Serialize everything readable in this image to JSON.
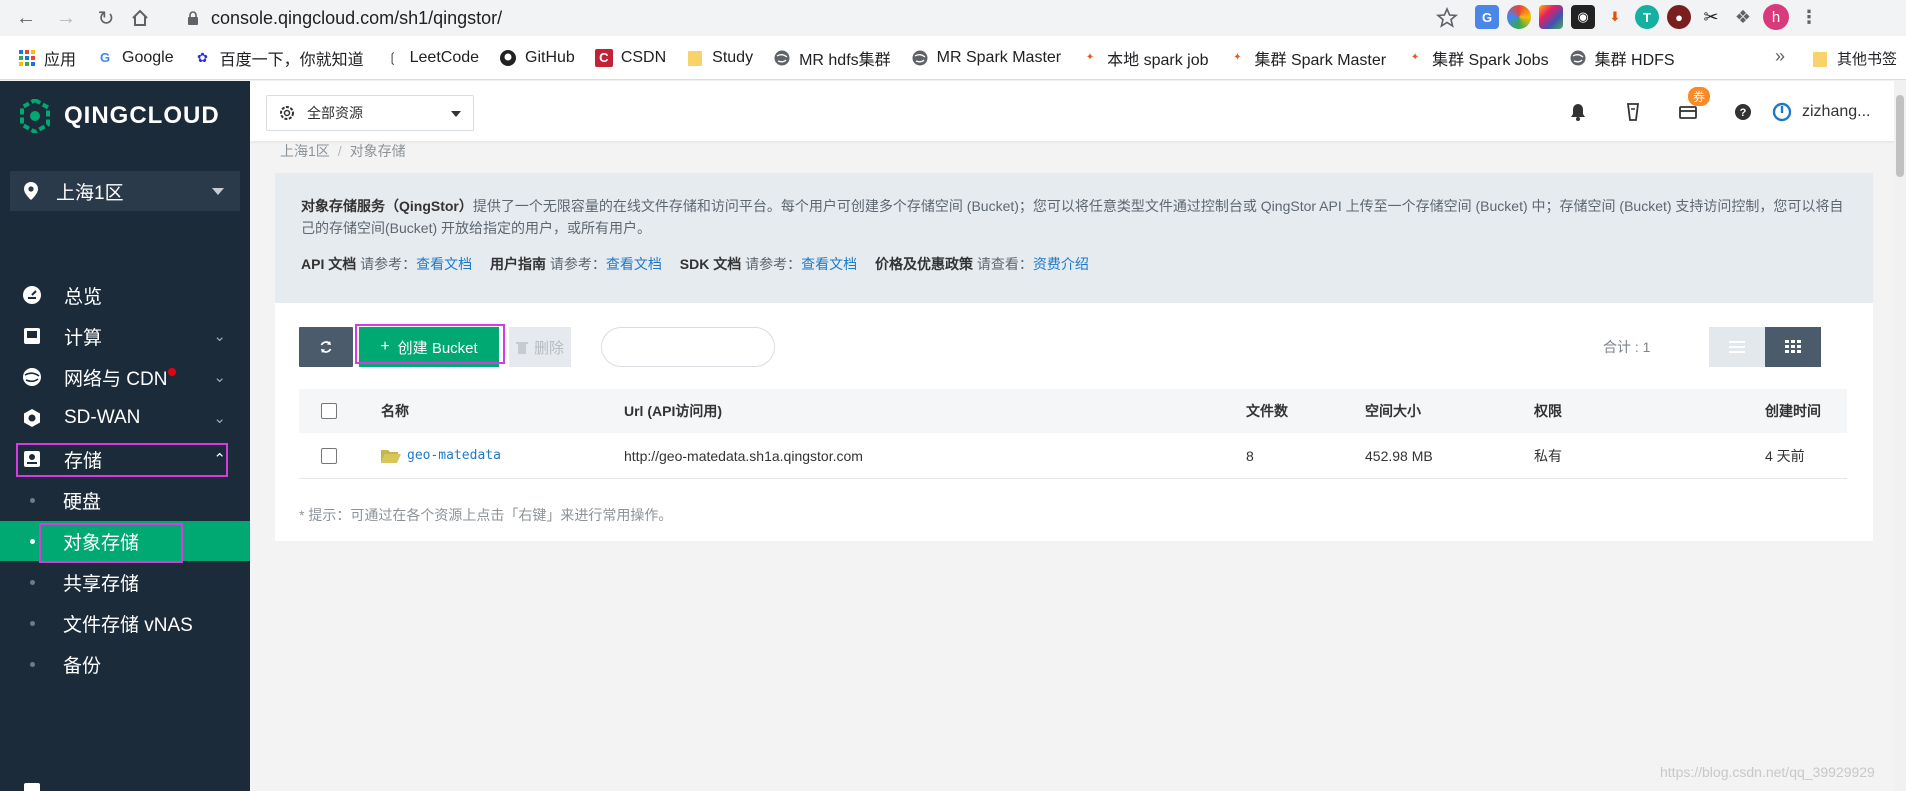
{
  "browser": {
    "url": "console.qingcloud.com/sh1/qingstor/",
    "profile_initial": "h",
    "bookmarks": [
      {
        "label": "应用",
        "icon": "apps-grid-icon"
      },
      {
        "label": "Google",
        "icon": "google-icon"
      },
      {
        "label": "百度一下，你就知道",
        "icon": "baidu-icon"
      },
      {
        "label": "LeetCode",
        "icon": "leetcode-icon"
      },
      {
        "label": "GitHub",
        "icon": "github-icon"
      },
      {
        "label": "CSDN",
        "icon": "csdn-icon"
      },
      {
        "label": "Study",
        "icon": "folder-icon"
      },
      {
        "label": "MR hdfs集群",
        "icon": "globe-icon"
      },
      {
        "label": "MR Spark Master",
        "icon": "globe-icon"
      },
      {
        "label": "本地 spark job",
        "icon": "spark-icon"
      },
      {
        "label": "集群 Spark Master",
        "icon": "spark-icon"
      },
      {
        "label": "集群 Spark Jobs",
        "icon": "spark-icon"
      },
      {
        "label": "集群 HDFS",
        "icon": "globe-icon"
      }
    ],
    "more": "»",
    "other_bookmarks": "其他书签"
  },
  "brand": {
    "name": "QINGCLOUD"
  },
  "region": {
    "label": "上海1区"
  },
  "sidebar": {
    "items": [
      {
        "label": "总览"
      },
      {
        "label": "计算"
      },
      {
        "label": "网络与 CDN"
      },
      {
        "label": "SD-WAN"
      },
      {
        "label": "存储"
      }
    ],
    "storage_children": [
      {
        "label": "硬盘"
      },
      {
        "label": "对象存储"
      },
      {
        "label": "共享存储"
      },
      {
        "label": "文件存储 vNAS"
      },
      {
        "label": "备份"
      }
    ]
  },
  "topbar": {
    "resource_select": "全部资源",
    "coupon": "券",
    "username": "zizhang..."
  },
  "breadcrumb": {
    "root": "上海1区",
    "sep": "/",
    "current": "对象存储"
  },
  "info": {
    "title": "对象存储服务（QingStor）",
    "desc": "提供了一个无限容量的在线文件存储和访问平台。每个用户可创建多个存储空间 (Bucket)；您可以将任意类型文件通过控制台或 QingStor API 上传至一个存储空间 (Bucket) 中；存储空间 (Bucket) 支持访问控制，您可以将自己的存储空间(Bucket) 开放给指定的用户，或所有用户。",
    "api_label": "API 文档",
    "api_ref": "请参考：",
    "api_link": "查看文档",
    "guide_label": "用户指南",
    "guide_ref": "请参考：",
    "guide_link": "查看文档",
    "sdk_label": "SDK 文档",
    "sdk_ref": "请参考：",
    "sdk_link": "查看文档",
    "price_label": "价格及优惠政策",
    "price_ref": "请查看：",
    "price_link": "资费介绍"
  },
  "toolbar": {
    "create_label": "创建 Bucket",
    "delete_label": "删除",
    "total": "合计 : 1"
  },
  "table": {
    "headers": [
      "名称",
      "Url (API访问用)",
      "文件数",
      "空间大小",
      "权限",
      "创建时间"
    ],
    "rows": [
      {
        "name": "geo-matedata",
        "url": "http://geo-matedata.sh1a.qingstor.com",
        "files": "8",
        "size": "452.98 MB",
        "perm": "私有",
        "created": "4 天前"
      }
    ]
  },
  "hint": "* 提示：可通过在各个资源上点击「右键」来进行常用操作。",
  "watermark": "https://blog.csdn.net/qq_39929929",
  "colors": {
    "accent": "#00a971",
    "sidebar": "#1c2b3a",
    "highlight": "#d63be0",
    "link": "#1e7ac9"
  }
}
